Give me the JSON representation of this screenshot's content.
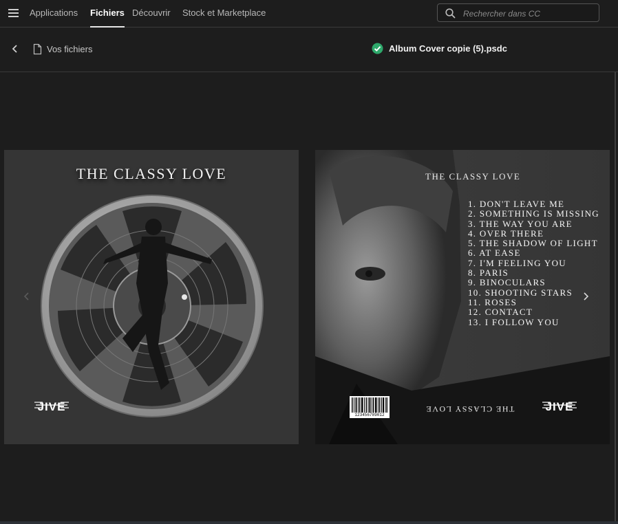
{
  "nav": {
    "tabs": [
      {
        "label": "Applications"
      },
      {
        "label": "Fichiers"
      },
      {
        "label": "Découvrir"
      },
      {
        "label": "Stock et Marketplace"
      }
    ],
    "active_tab": "Fichiers",
    "search": {
      "placeholder": "Rechercher dans CC",
      "value": ""
    }
  },
  "subbar": {
    "breadcrumb": "Vos fichiers",
    "file_name": "Album Cover copie (5).psdc",
    "sync_status_color": "#2ea86b"
  },
  "front_cover": {
    "title": "THE CLASSY LOVE",
    "logo_text": "JIVE"
  },
  "back_cover": {
    "title": "THE CLASSY LOVE",
    "tracks": [
      "1. DON'T LEAVE ME",
      "2. SOMETHING IS MISSING",
      "3. THE WAY YOU ARE",
      "4. OVER THERE",
      "5. THE SHADOW OF LIGHT",
      "6. AT EASE",
      "7. I'M FEELING YOU",
      "8. PARIS",
      "9. BINOCULARS",
      "10. SHOOTING STARS",
      "11. ROSES",
      "12. CONTACT",
      "13. I FOLLOW YOU"
    ],
    "mirrored_text": "THE CLASSY LOVE",
    "barcode_number": "123456789012",
    "logo_text": "JIVE"
  },
  "icons": {
    "menu": "hamburger-icon",
    "search": "search-icon",
    "back": "chevron-left-icon",
    "file": "document-icon",
    "status": "check-circle-icon",
    "next": "chevron-right-icon",
    "prev": "chevron-left-icon"
  }
}
